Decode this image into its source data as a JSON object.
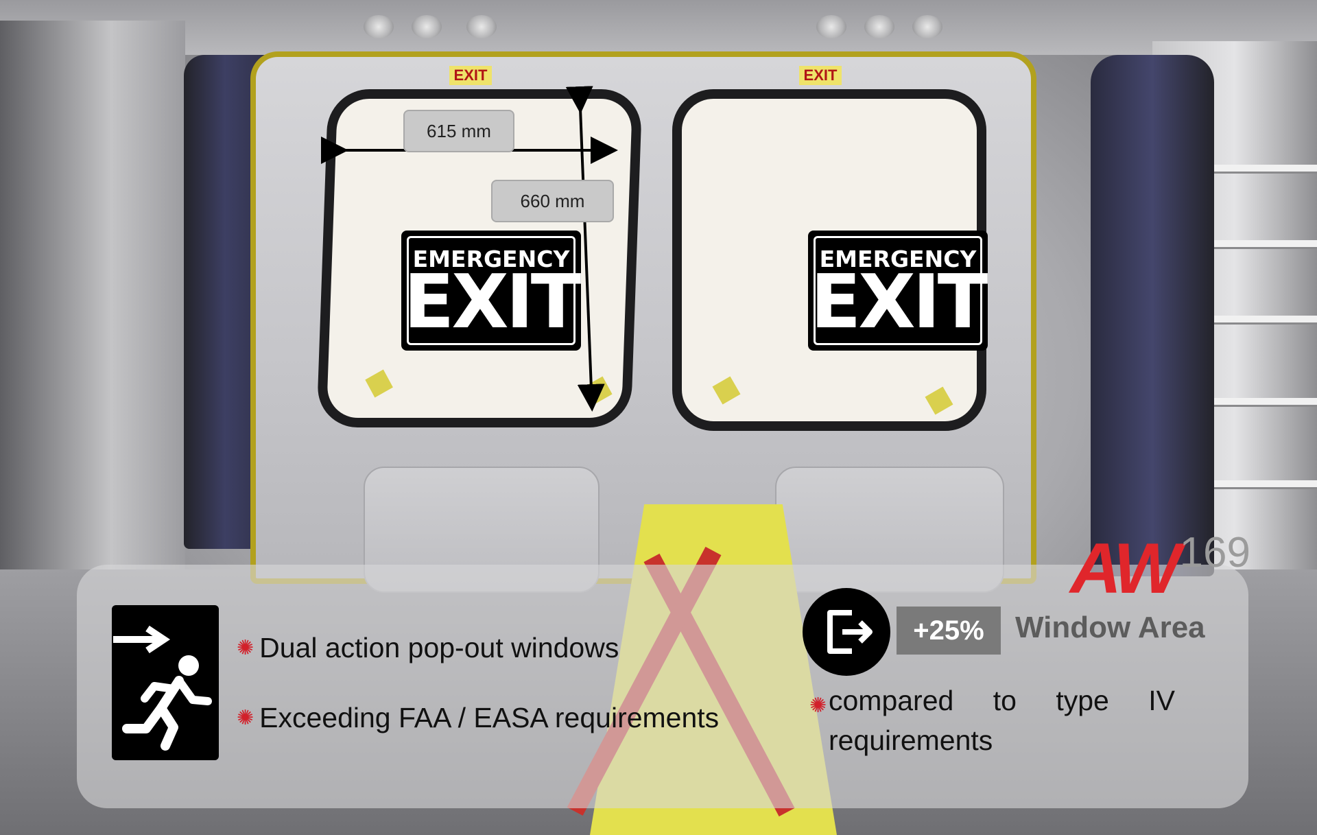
{
  "window_labels": {
    "width": "615 mm",
    "height": "660 mm"
  },
  "exit_tags": [
    "EXIT",
    "EXIT"
  ],
  "signs": [
    {
      "top": "EMERGENCY",
      "bottom": "EXIT"
    },
    {
      "top": "EMERGENCY",
      "bottom": "EXIT"
    }
  ],
  "bullets": [
    "Dual action pop-out windows",
    "Exceeding FAA / EASA requirements"
  ],
  "badge": {
    "value": "+25%",
    "label": "Window Area"
  },
  "comparison": {
    "words": [
      "compared",
      "to",
      "type",
      "IV"
    ],
    "line2": "requirements"
  },
  "logo": {
    "brand": "AW",
    "model": "169"
  },
  "colors": {
    "accent_red": "#d2202a",
    "badge_gray": "#7a7a7a"
  },
  "icons": [
    "emergency-exit-running-icon",
    "exit-door-arrow-icon",
    "bullet-burst-icon"
  ]
}
